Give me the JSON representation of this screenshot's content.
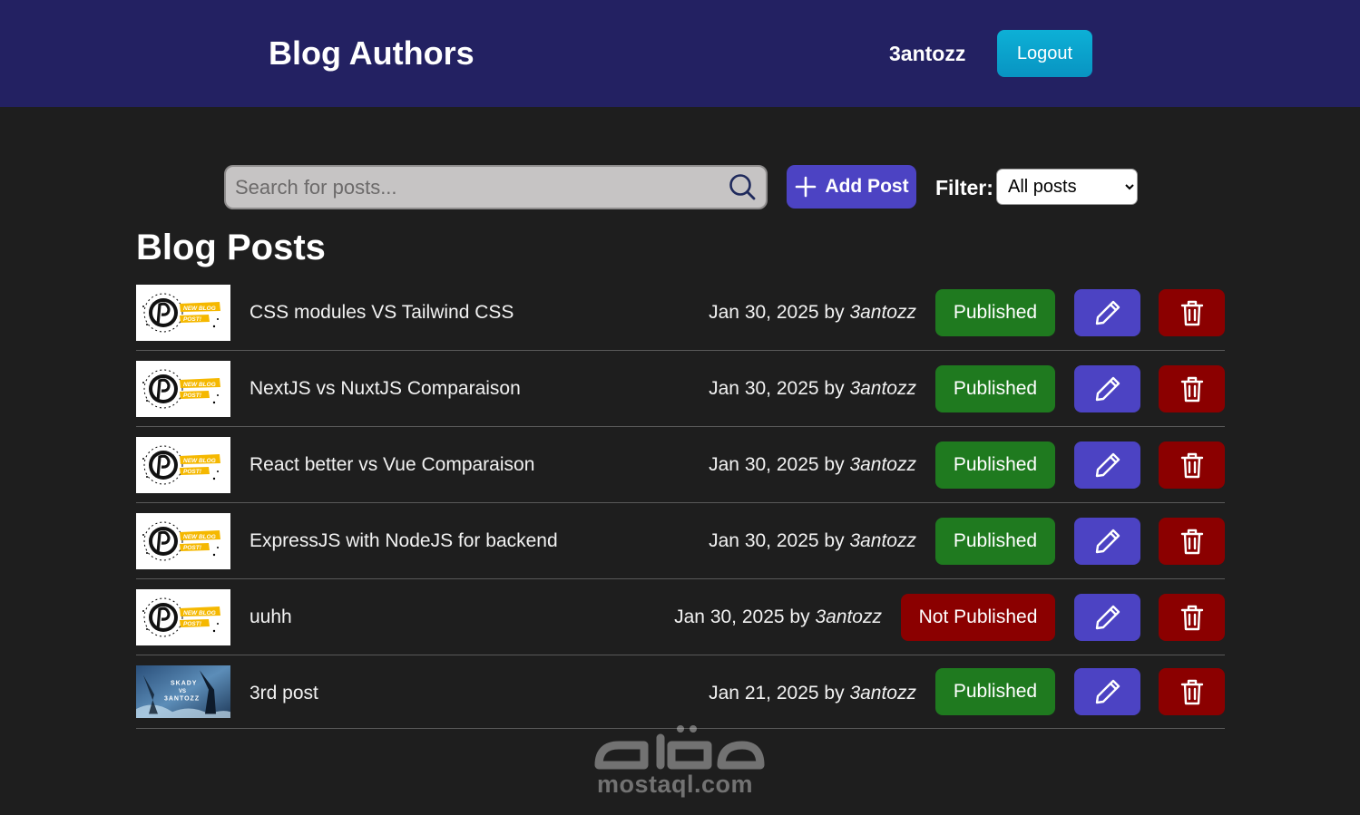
{
  "header": {
    "title": "Blog Authors",
    "username": "3antozz",
    "logout_label": "Logout"
  },
  "toolbar": {
    "search_placeholder": "Search for posts...",
    "add_post_label": "Add Post",
    "filter_label": "Filter:",
    "filter_selected": "All posts"
  },
  "section_title": "Blog Posts",
  "by_label": "by",
  "posts": [
    {
      "title": "CSS modules VS Tailwind CSS",
      "date": "Jan 30, 2025",
      "author": "3antozz",
      "status": "Published",
      "thumb": "new-blog-post"
    },
    {
      "title": "NextJS vs NuxtJS Comparaison",
      "date": "Jan 30, 2025",
      "author": "3antozz",
      "status": "Published",
      "thumb": "new-blog-post"
    },
    {
      "title": "React better vs Vue Comparaison",
      "date": "Jan 30, 2025",
      "author": "3antozz",
      "status": "Published",
      "thumb": "new-blog-post"
    },
    {
      "title": "ExpressJS with NodeJS for backend",
      "date": "Jan 30, 2025",
      "author": "3antozz",
      "status": "Published",
      "thumb": "new-blog-post"
    },
    {
      "title": "uuhh",
      "date": "Jan 30, 2025",
      "author": "3antozz",
      "status": "Not Published",
      "thumb": "new-blog-post"
    },
    {
      "title": "3rd post",
      "date": "Jan 21, 2025",
      "author": "3antozz",
      "status": "Published",
      "thumb": "game-art"
    }
  ],
  "thumb_text": {
    "line1": "NEW BLOG",
    "line2": "POST!",
    "game_line1": "SKADY",
    "game_line2": "VS",
    "game_line3": "3ANTOZZ"
  },
  "watermark": {
    "text": "mostaql.com",
    "logo": "مستقل"
  },
  "icons": {
    "search": "search-icon",
    "add": "plus-icon",
    "edit": "pencil-icon",
    "delete": "trash-icon"
  },
  "colors": {
    "header_bg": "#232162",
    "page_bg": "#1e1e1e",
    "accent": "#4c43c3",
    "published": "#1f7a1f",
    "danger": "#8b0000",
    "logout": "#0db0d6"
  }
}
